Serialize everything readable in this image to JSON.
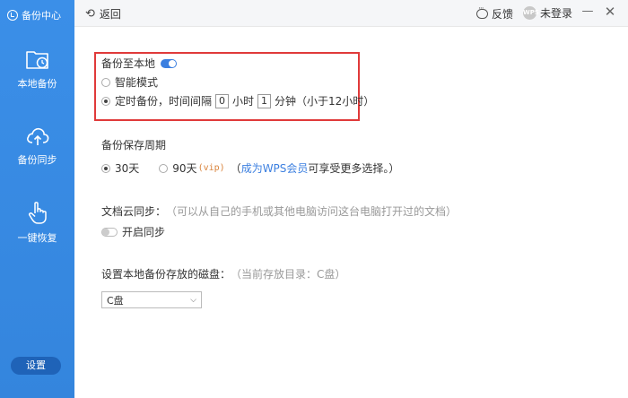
{
  "sidebar": {
    "brand": "备份中心",
    "items": [
      {
        "label": "本地备份",
        "icon": "folder-clock-icon"
      },
      {
        "label": "备份同步",
        "icon": "cloud-upload-icon"
      },
      {
        "label": "一键恢复",
        "icon": "hand-pointer-icon"
      }
    ],
    "settings_label": "设置"
  },
  "topbar": {
    "back_label": "返回",
    "feedback_label": "反馈",
    "avatar_text": "WPS",
    "user_label": "未登录",
    "minimize_glyph": "—",
    "close_glyph": "✕"
  },
  "local_backup": {
    "title": "备份至本地",
    "toggle_on": true,
    "option_smart": "智能模式",
    "option_timed_prefix": "定时备份，时间间隔",
    "hours_value": "0",
    "hours_unit": "小时",
    "minutes_value": "1",
    "minutes_unit": "分钟（小于12小时）"
  },
  "retention": {
    "title": "备份保存周期",
    "option_30": "30天",
    "option_90": "90天",
    "vip_tag": "(vip)",
    "note_open": "（",
    "link": "成为WPS会员",
    "note_rest": " 可享受更多选择。）"
  },
  "cloud_sync": {
    "title": "文档云同步：",
    "hint": "（可以从自己的手机或其他电脑访问这台电脑打开过的文档）",
    "toggle_label": "开启同步"
  },
  "disk": {
    "title": "设置本地备份存放的磁盘：",
    "hint": "（当前存放目录：C盘）",
    "selected": "C盘",
    "arrow": "⌵"
  },
  "colors": {
    "sidebar": "#3b8fe8",
    "accent": "#3b7fe0",
    "highlight": "#e03a3a",
    "vip": "#d9833b"
  }
}
